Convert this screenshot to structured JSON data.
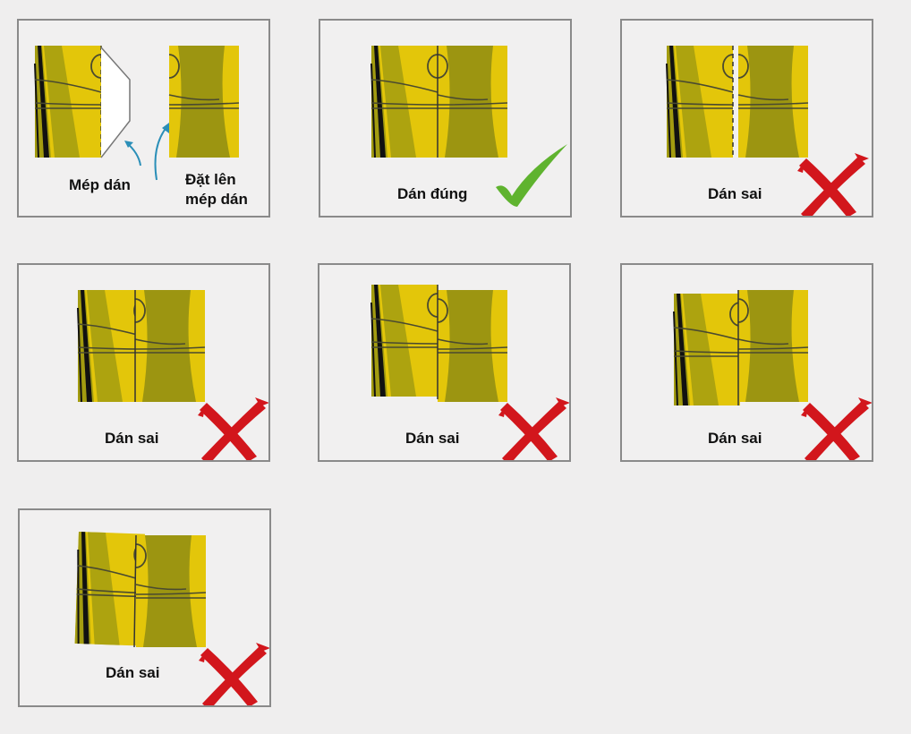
{
  "colors": {
    "yellow": "#e3c60a",
    "olive": "#a39c10",
    "olive_dark": "#9c9511",
    "line": "#4a4a30",
    "check_green": "#5fb32f",
    "cross_red": "#d2161c",
    "arrow_blue": "#2b8fb8",
    "border": "#8a8a8a"
  },
  "panels": [
    {
      "caption_left": "Mép dán",
      "caption_right_line1": "Đặt lên",
      "caption_right_line2": "mép dán",
      "mark": "curved-arrow-icon"
    },
    {
      "caption": "Dán đúng",
      "mark": "checkmark-icon"
    },
    {
      "caption": "Dán sai",
      "mark": "cross-icon"
    },
    {
      "caption": "Dán sai",
      "mark": "cross-icon"
    },
    {
      "caption": "Dán sai",
      "mark": "cross-icon"
    },
    {
      "caption": "Dán sai",
      "mark": "cross-icon"
    },
    {
      "caption": "Dán sai",
      "mark": "cross-icon"
    }
  ]
}
